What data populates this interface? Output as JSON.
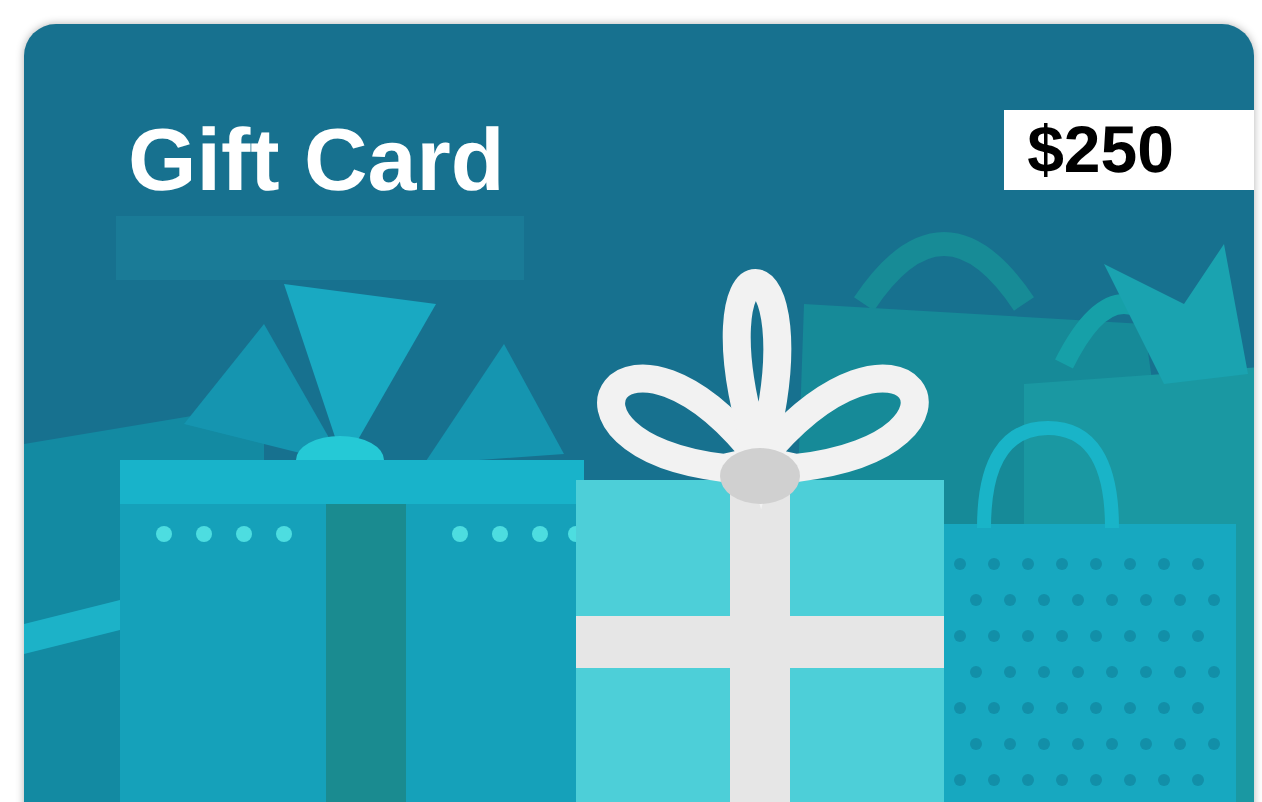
{
  "card": {
    "title": "Gift Card",
    "amount": "$250"
  }
}
